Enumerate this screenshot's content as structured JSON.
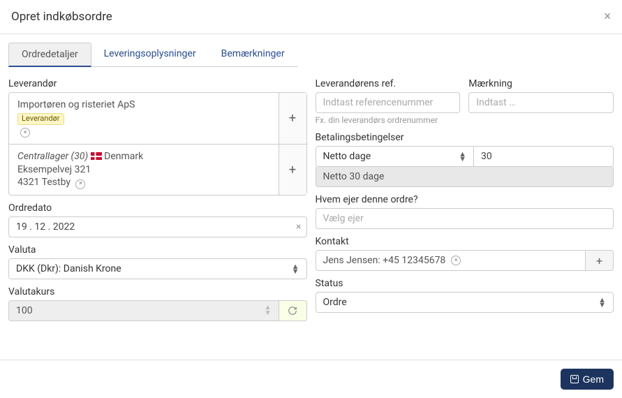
{
  "header": {
    "title": "Opret indkøbsordre"
  },
  "tabs": {
    "t0": "Ordredetaljer",
    "t1": "Leveringsoplysninger",
    "t2": "Bemærkninger"
  },
  "left": {
    "supplier_label": "Leverandør",
    "supplier_name": "Importøren og risteriet ApS",
    "supplier_badge": "Leverandør",
    "warehouse_name": "Centrallager (30)",
    "warehouse_country": "Denmark",
    "warehouse_addr1": "Eksempelvej 321",
    "warehouse_addr2": "4321 Testby",
    "orderdate_label": "Ordredato",
    "orderdate_value": "19 . 12 . 2022",
    "currency_label": "Valuta",
    "currency_value": "DKK (Dkr): Danish Krone",
    "rate_label": "Valutakurs",
    "rate_value": "100"
  },
  "right": {
    "ref_label": "Leverandørens ref.",
    "ref_placeholder": "Indtast referencenummer",
    "ref_help": "Fx. din leverandørs ordrenummer",
    "mark_label": "Mærkning",
    "mark_placeholder": "Indtast …",
    "pay_label": "Betalingsbetingelser",
    "pay_type": "Netto dage",
    "pay_days": "30",
    "pay_summary": "Netto 30 dage",
    "owner_label": "Hvem ejer denne ordre?",
    "owner_placeholder": "Vælg ejer",
    "contact_label": "Kontakt",
    "contact_value": "Jens Jensen: +45 12345678",
    "status_label": "Status",
    "status_value": "Ordre"
  },
  "footer": {
    "save": "Gem"
  }
}
